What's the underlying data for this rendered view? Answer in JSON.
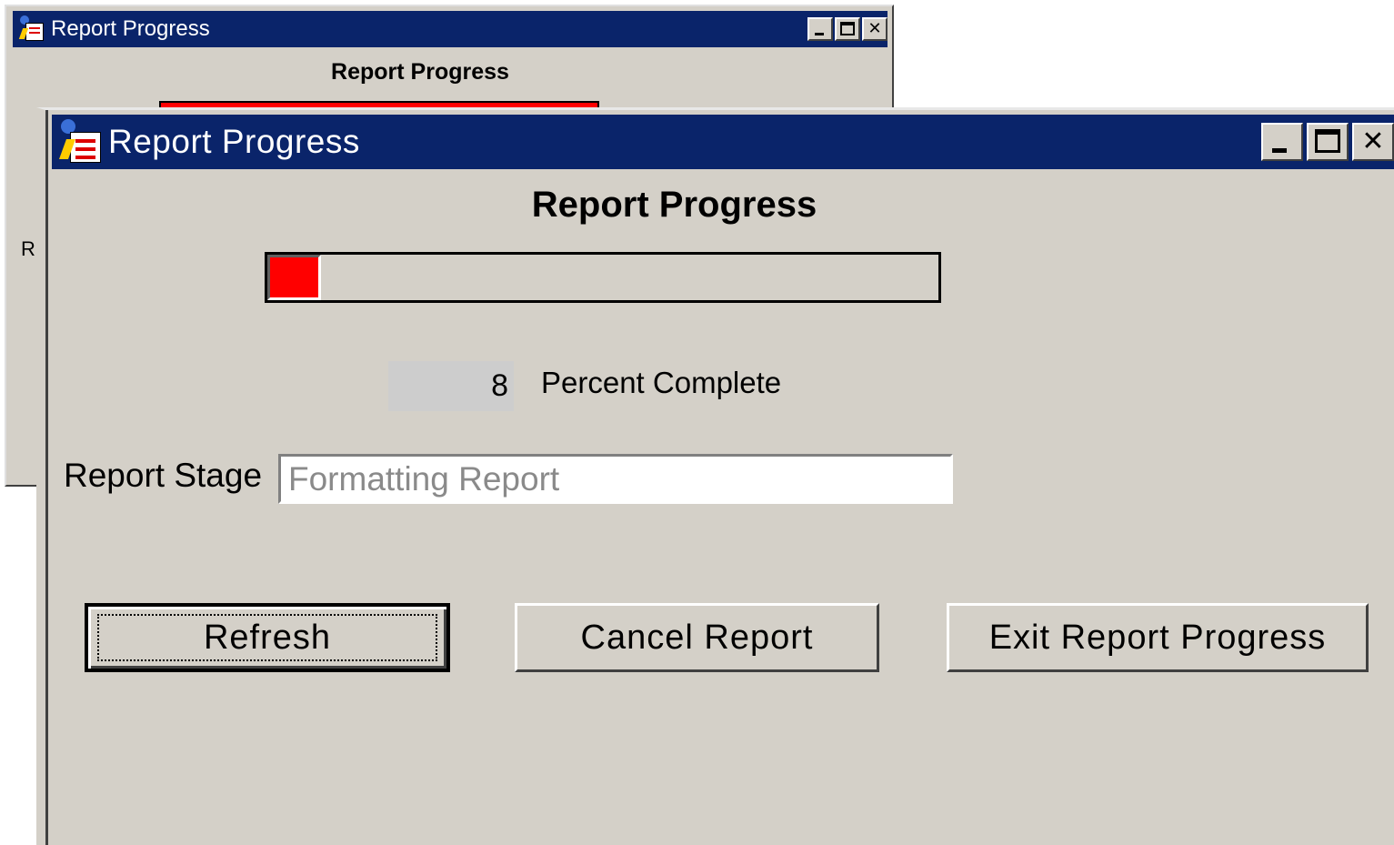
{
  "back_window": {
    "title": "Report Progress",
    "heading": "Report Progress",
    "stage_label_partial": "R",
    "buttons": {
      "minimize": "minimize",
      "maximize": "maximize",
      "close": "✕"
    }
  },
  "front_window": {
    "title": "Report Progress",
    "heading": "Report Progress",
    "progress": {
      "percent": 8,
      "color": "#ff0000"
    },
    "percent_value": "8",
    "percent_label": "Percent Complete",
    "stage_label": "Report Stage",
    "stage_value": "Formatting Report",
    "buttons": {
      "refresh": "Refresh",
      "cancel": "Cancel Report",
      "exit": "Exit Report Progress",
      "close": "✕"
    }
  },
  "colors": {
    "titlebar": "#0a246a",
    "window_bg": "#d4d0c8",
    "progress_fill": "#ff0000"
  },
  "icons": [
    "report-app-icon",
    "minimize-icon",
    "maximize-icon",
    "close-icon"
  ]
}
